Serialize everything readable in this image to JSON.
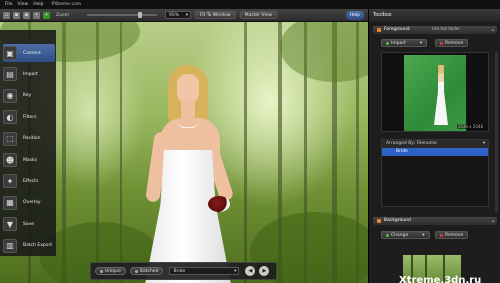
{
  "menu": {
    "items": [
      "File",
      "View",
      "Help"
    ],
    "site": "PXbeme.com"
  },
  "toolbar": {
    "zoom_label": "Zoom",
    "zoom_level": "95%",
    "zoom_fraction": 0.78,
    "fit_label": "Fit To Window",
    "master_view_label": "Master View",
    "help_label": "Help"
  },
  "side": {
    "items": [
      {
        "label": "Camera",
        "icon": "camera-icon",
        "glyph": "▣",
        "active": true
      },
      {
        "label": "Import",
        "icon": "import-icon",
        "glyph": "▤",
        "active": false
      },
      {
        "label": "Key",
        "icon": "key-icon",
        "glyph": "◉",
        "active": false
      },
      {
        "label": "Filters",
        "icon": "filters-icon",
        "glyph": "◐",
        "active": false
      },
      {
        "label": "Position",
        "icon": "position-icon",
        "glyph": "⬚",
        "active": false
      },
      {
        "label": "Masks",
        "icon": "masks-icon",
        "glyph": "☻",
        "active": false
      },
      {
        "label": "Effects",
        "icon": "effects-icon",
        "glyph": "✦",
        "active": false
      },
      {
        "label": "Overlay",
        "icon": "overlay-icon",
        "glyph": "▦",
        "active": false
      },
      {
        "label": "Save",
        "icon": "save-icon",
        "glyph": "▼",
        "active": false
      },
      {
        "label": "Batch Export",
        "icon": "batch-export-icon",
        "glyph": "▥",
        "active": false
      }
    ]
  },
  "bottom": {
    "unique_label": "Unique",
    "batched_label": "Batched",
    "selected": "Bride"
  },
  "toolbox": {
    "title": "Toolbox",
    "foreground": {
      "title": "Foreground",
      "hot_folder": "Use hot folder",
      "import_label": "Import",
      "remove_label": "Remove",
      "thumb_size": "1536 x 2048",
      "arranged_by": "Arranged By: Filename",
      "items": [
        "Bride"
      ]
    },
    "background": {
      "title": "Background",
      "change_label": "Change",
      "remove_label": "Remove"
    }
  },
  "watermark": "Xtreme.3dn.ru"
}
